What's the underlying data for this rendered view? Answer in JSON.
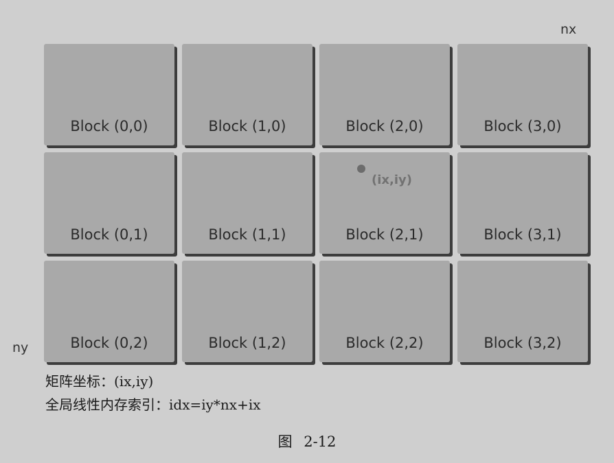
{
  "axes": {
    "x_label": "nx",
    "y_label": "ny"
  },
  "blocks": [
    {
      "label": "Block (0,0)",
      "col": 0,
      "row": 0
    },
    {
      "label": "Block (1,0)",
      "col": 1,
      "row": 0
    },
    {
      "label": "Block (2,0)",
      "col": 2,
      "row": 0
    },
    {
      "label": "Block (3,0)",
      "col": 3,
      "row": 0
    },
    {
      "label": "Block (0,1)",
      "col": 0,
      "row": 1
    },
    {
      "label": "Block (1,1)",
      "col": 1,
      "row": 1
    },
    {
      "label": "Block (2,1)",
      "col": 2,
      "row": 1
    },
    {
      "label": "Block (3,1)",
      "col": 3,
      "row": 1
    },
    {
      "label": "Block (0,2)",
      "col": 0,
      "row": 2
    },
    {
      "label": "Block (1,2)",
      "col": 1,
      "row": 2
    },
    {
      "label": "Block (2,2)",
      "col": 2,
      "row": 2
    },
    {
      "label": "Block (3,2)",
      "col": 3,
      "row": 2
    }
  ],
  "thread_marker": {
    "label": "(ix,iy)",
    "block": "Block (2,1)"
  },
  "captions": {
    "matrix_coordinate": "矩阵坐标：(ix,iy)",
    "global_index": "全局线性内存索引：idx=iy*nx+ix"
  },
  "figure_number": "图 2-12",
  "colors": {
    "background": "#cfcfcf",
    "block_fill": "#a9a9a9",
    "block_shadow": "#3d3d3d",
    "marker": "#6c6c6c"
  }
}
